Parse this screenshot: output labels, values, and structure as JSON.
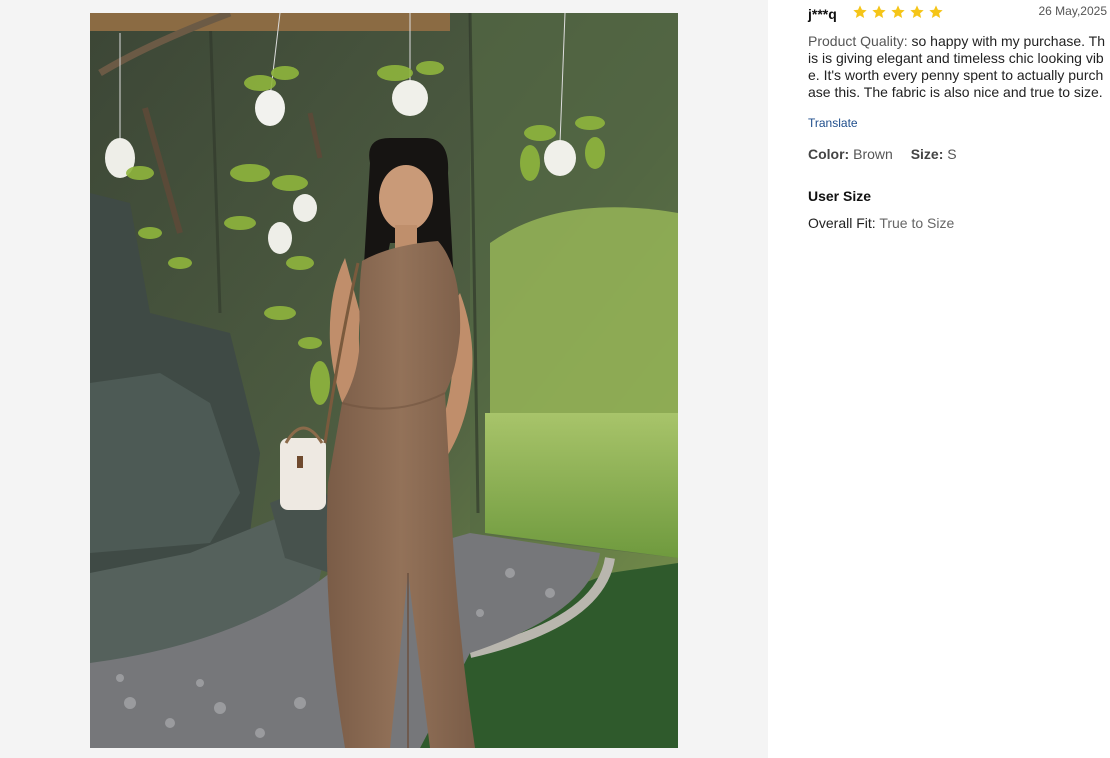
{
  "photo": {
    "alt": "Customer wearing brown one-shoulder jumpsuit in front of hanging plants backdrop",
    "product_color": "#8d6c55"
  },
  "review": {
    "username": "j***q",
    "rating": 5,
    "rating_max": 5,
    "star_color": "#f5c518",
    "date": "26 May,2025",
    "quality_label": "Product Quality:",
    "quality_text": " so happy with my purchase. This is giving elegant and timeless chic looking vibe. It's worth every penny spent to actually purchase this. The fabric is also nice and true to size.",
    "translate_label": "Translate",
    "color_label": "Color:",
    "color_value": "Brown",
    "size_label": "Size:",
    "size_value": "S",
    "user_size_title": "User Size",
    "fit_label": "Overall Fit:",
    "fit_value": "True to Size"
  }
}
